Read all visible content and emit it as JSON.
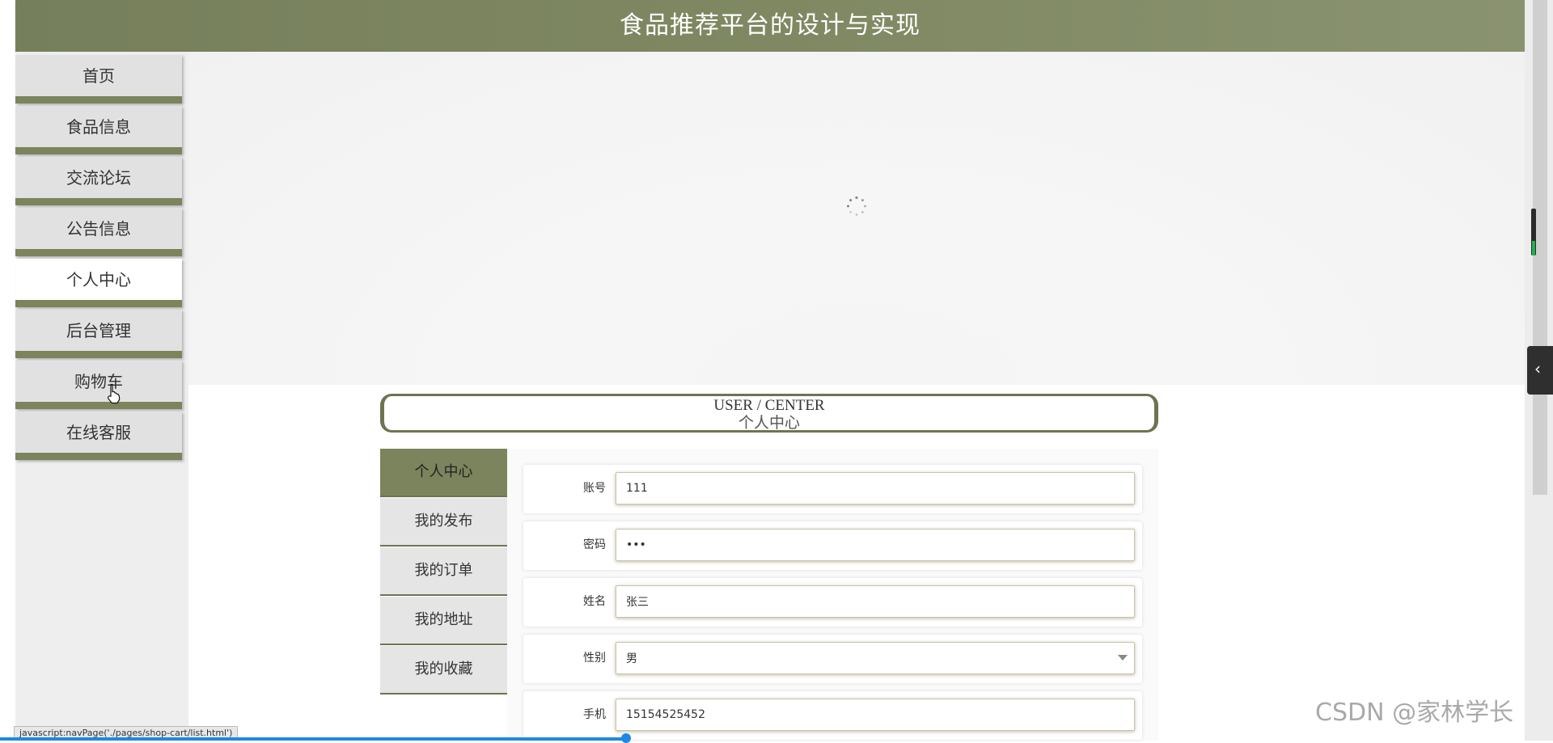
{
  "header": {
    "title": "食品推荐平台的设计与实现"
  },
  "sidebar": {
    "items": [
      {
        "label": "首页"
      },
      {
        "label": "食品信息"
      },
      {
        "label": "交流论坛"
      },
      {
        "label": "公告信息"
      },
      {
        "label": "个人中心"
      },
      {
        "label": "后台管理"
      },
      {
        "label": "购物车"
      },
      {
        "label": "在线客服"
      }
    ],
    "active": "个人中心"
  },
  "section": {
    "title_en": "USER / CENTER",
    "title_cn": "个人中心"
  },
  "tabs": {
    "items": [
      {
        "label": "个人中心"
      },
      {
        "label": "我的发布"
      },
      {
        "label": "我的订单"
      },
      {
        "label": "我的地址"
      },
      {
        "label": "我的收藏"
      }
    ],
    "active": "个人中心"
  },
  "form": {
    "account": {
      "label": "账号",
      "value": "111"
    },
    "password": {
      "label": "密码",
      "value": "•••"
    },
    "name": {
      "label": "姓名",
      "value": "张三"
    },
    "gender": {
      "label": "性别",
      "value": "男"
    },
    "phone": {
      "label": "手机",
      "value": "15154525452"
    }
  },
  "status_bar": {
    "url": "javascript:navPage('./pages/shop-cart/list.html')"
  },
  "watermark": "CSDN @家林学长",
  "colors": {
    "accent": "#7b845c",
    "header": "#7f8862"
  },
  "icons": {
    "spinner": "loading-spinner-icon",
    "side_tab": "chevron-left-icon",
    "cursor": "hand-pointer-icon",
    "select": "caret-down-icon"
  }
}
